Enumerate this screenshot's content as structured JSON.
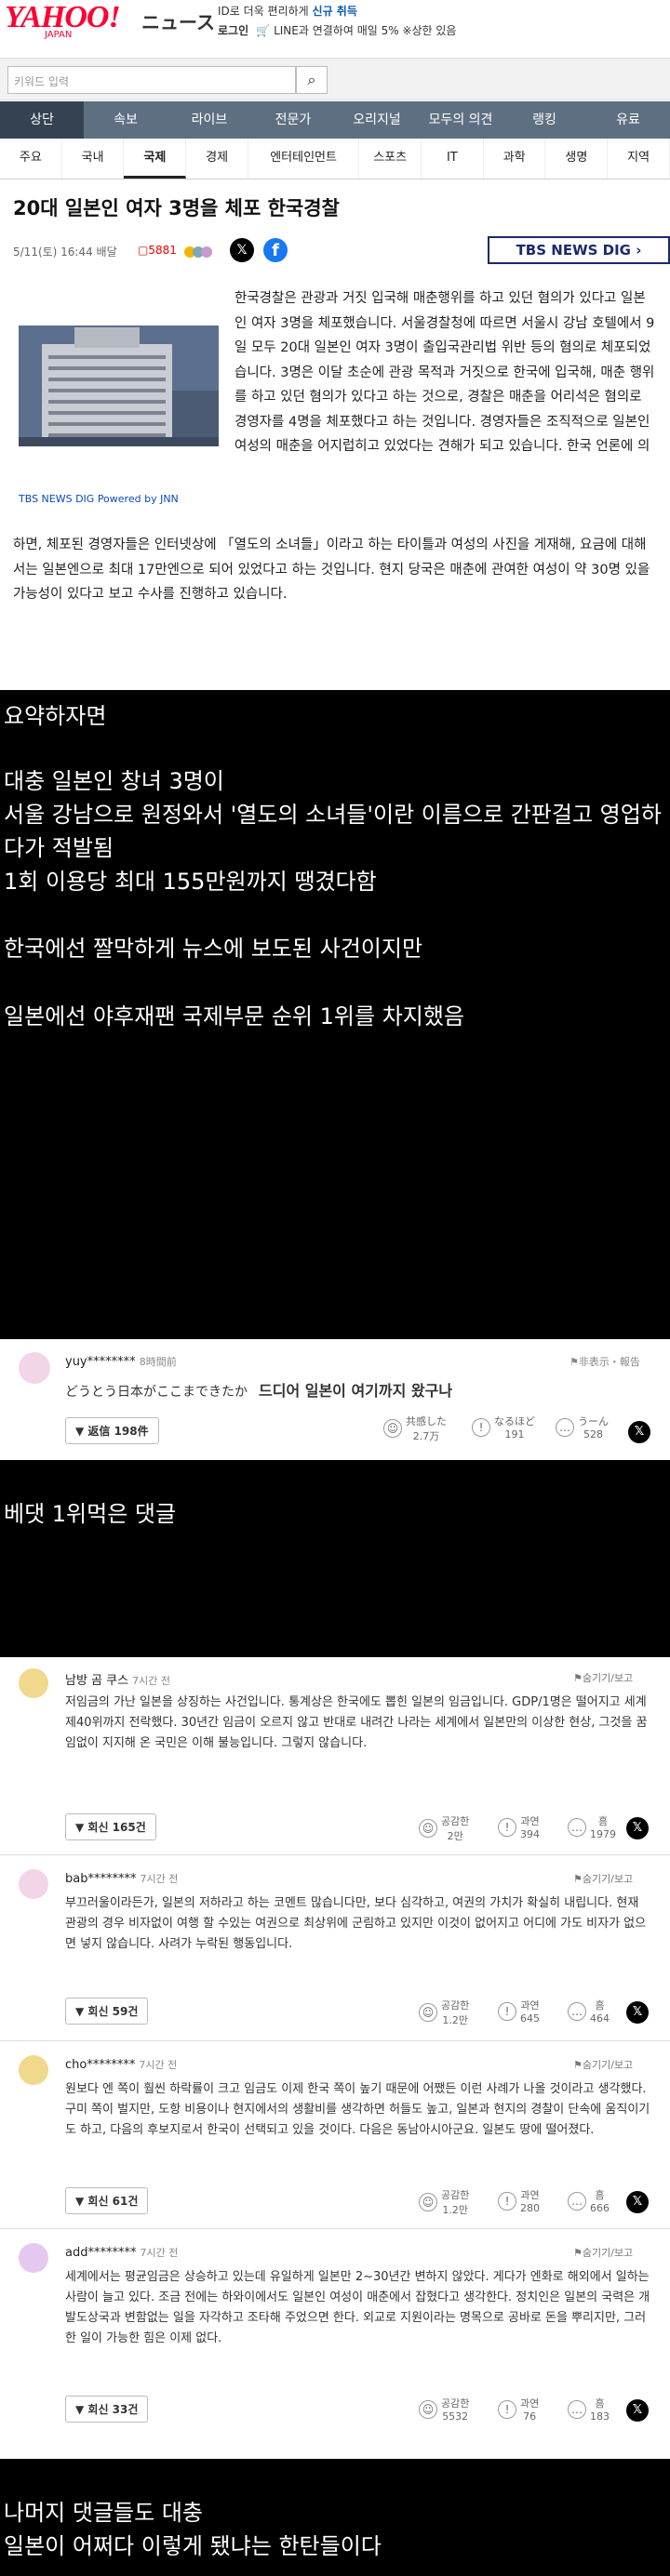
{
  "header": {
    "logo": "YAHOO!",
    "logo_sub": "JAPAN",
    "service": "ニュース",
    "promo_line1_prefix": "ID로 더욱 편리하게",
    "promo_line1_link": "신규 취득",
    "promo_line2_login": "로그인",
    "promo_line2_text": "LINE과 연결하여 매일 5% ※상한 있음",
    "search_placeholder": "키워드 입력"
  },
  "categories": [
    "상단",
    "속보",
    "라이브",
    "전문가",
    "오리지널",
    "모두의 의견",
    "랭킹",
    "유료"
  ],
  "subcategories": [
    "주요",
    "국내",
    "국제",
    "경제",
    "엔터테인먼트",
    "스포츠",
    "IT",
    "과학",
    "생명",
    "지역"
  ],
  "article": {
    "title": "20대 일본인 여자 3명을 체포 한국경찰",
    "meta": "5/11(토) 16:44 배달",
    "comment_count": "5881",
    "source_badge": "TBS NEWS DIG",
    "photo_caption": "TBS NEWS DIG Powered by JNN",
    "body_side": "한국경찰은 관광과 거짓 입국해 매춘행위를 하고 있던 혐의가 있다고 일본인 여자 3명을 체포했습니다. 서울경찰청에 따르면 서울시 강남 호텔에서 9일 모두 20대 일본인 여자 3명이 출입국관리법 위반 등의 혐의로 체포되었습니다. 3명은 이달 초순에 관광 목적과 거짓으로 한국에 입국해, 매춘 행위를 하고 있던 혐의가 있다고 하는 것으로, 경찰은 매춘을 어리석은 혐의로 경영자를 4명을 체포했다고 하는 것입니다. 경영자들은 조직적으로 일본인 여성의 매춘을 어지럽히고 있었다는 견해가 되고 있습니다. 한국 언론에 의",
    "body_full": "하면, 체포된 경영자들은 인터넷상에 「열도의 소녀들」이라고 하는 타이틀과 여성의 사진을 게재해, 요금에 대해서는 일본엔으로 최대 17만엔으로 되어 있었다고 하는 것입니다. 현지 당국은 매춘에 관여한 여성이 약 30명 있을 가능성이 있다고 보고 수사를 진행하고 있습니다."
  },
  "summary": {
    "heading": "요약하자면",
    "line1": "대충 일본인 창녀 3명이",
    "line2": "서울 강남으로 원정와서 '열도의 소녀들'이란 이름으로 간판걸고 영업하다가 적발됨",
    "line3": "1회 이용당 최대 155만원까지 땡겼다함",
    "line4": "한국에선 짤막하게 뉴스에 보도된 사건이지만",
    "line5": "일본에선 야후재팬 국제부문 순위 1위를 차지했음"
  },
  "top_comment": {
    "user": "yuy********",
    "time": "8時間前",
    "report": "非表示・報告",
    "original": "どうとう日本がここまできたか",
    "translation": "드디어 일본이 여기까지 왔구나",
    "reply_button": "返信 198件",
    "votes": [
      {
        "label": "共感した",
        "count": "2.7万"
      },
      {
        "label": "なるほど",
        "count": "191"
      },
      {
        "label": "うーん",
        "count": "528"
      }
    ]
  },
  "best_label": "베댓 1위먹은 댓글",
  "comments": [
    {
      "user": "남방 곰 쿠스",
      "time": "7시간 전",
      "hide": "숨기기/보고",
      "text": "저임금의 가난 일본을 상징하는 사건입니다. 통계상은 한국에도 뽑힌 일본의 임금입니다. GDP/1명은 떨어지고 세계 제40위까지 전락했다. 30년간 임금이 오르지 않고 반대로 내려간 나라는 세계에서 일본만의 이상한 현상, 그것을 꿈임없이 지지해 온 국민은 이해 불능입니다. 그렇지 않습니다.",
      "reply": "회신 165건",
      "votes": [
        {
          "label": "공감한",
          "count": "2만"
        },
        {
          "label": "과연",
          "count": "394"
        },
        {
          "label": "흠",
          "count": "1979"
        }
      ]
    },
    {
      "user": "bab********",
      "time": "7시간 전",
      "hide": "숨기기/보고",
      "text": "부끄러울이라든가, 일본의 저하라고 하는 코멘트 많습니다만, 보다 심각하고, 여권의 가치가 확실히 내립니다. 현재 관광의 경우 비자없이 여행 할 수있는 여권으로 최상위에 군림하고 있지만 이것이 없어지고 어디에 가도 비자가 없으면 넣지 않습니다. 사려가 누락된 행동입니다.",
      "reply": "회신 59건",
      "votes": [
        {
          "label": "공감한",
          "count": "1.2만"
        },
        {
          "label": "과연",
          "count": "645"
        },
        {
          "label": "흠",
          "count": "464"
        }
      ]
    },
    {
      "user": "cho********",
      "time": "7시간 전",
      "hide": "숨기기/보고",
      "text": "원보다 엔 쪽이 훨씬 하락률이 크고 임금도 이제 한국 쪽이 높기 때문에 어쨌든 이런 사례가 나올 것이라고 생각했다. 구미 쪽이 벌지만, 도항 비용이나 현지에서의 생활비를 생각하면 허들도 높고, 일본과 현지의 경찰이 단속에 움직이기도 하고, 다음의 후보지로서 한국이 선택되고 있을 것이다. 다음은 동남아시아군요. 일본도 땅에 떨어졌다.",
      "reply": "회신 61건",
      "votes": [
        {
          "label": "공감한",
          "count": "1.2만"
        },
        {
          "label": "과연",
          "count": "280"
        },
        {
          "label": "흠",
          "count": "666"
        }
      ]
    },
    {
      "user": "add********",
      "time": "7시간 전",
      "hide": "숨기기/보고",
      "text": "세계에서는 평균임금은 상승하고 있는데 유일하게 일본만 2~30년간 변하지 않았다. 게다가 엔화로 해외에서 일하는 사람이 늘고 있다. 조금 전에는 하와이에서도 일본인 여성이 매춘에서 잡혔다고 생각한다. 정치인은 일본의 국력은 개발도상국과 변함없는 일을 자각하고 조타해 주었으면 한다. 외교로 지원이라는 명목으로 공바로 돈을 뿌리지만, 그러한 일이 가능한 힘은 이제 없다.",
      "reply": "회신 33건",
      "votes": [
        {
          "label": "공감한",
          "count": "5532"
        },
        {
          "label": "과연",
          "count": "76"
        },
        {
          "label": "흠",
          "count": "183"
        }
      ]
    }
  ],
  "footer": {
    "line1": "나머지 댓글들도 대충",
    "line2": "일본이 어쩌다 이렇게 됐냐는 한탄들이다"
  },
  "colors": {
    "yahoo_red": "#ff0033",
    "nav": "#5f6f82",
    "nav_active": "#354251",
    "link": "#0a5ab8"
  }
}
